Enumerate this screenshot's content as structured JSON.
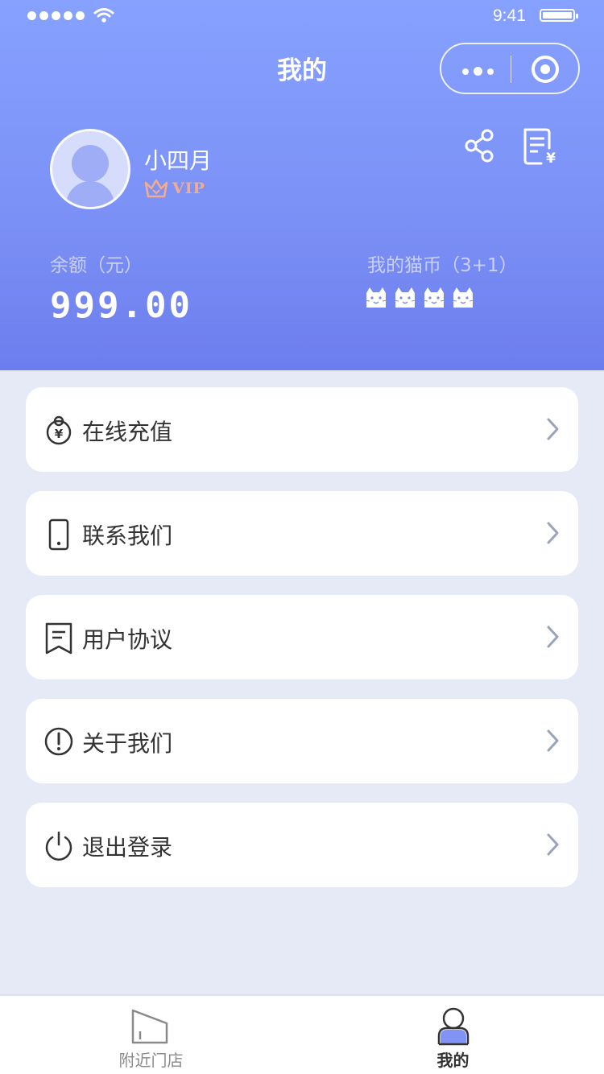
{
  "status_bar": {
    "time": "9:41"
  },
  "header": {
    "title": "我的"
  },
  "profile": {
    "name": "小四月",
    "vip_label": "VIP"
  },
  "wallet": {
    "balance_label": "余额（元）",
    "balance_value": "999.00",
    "coins_label": "我的猫币（3+1）",
    "coins_count": 4
  },
  "menu": [
    {
      "label": "在线充值",
      "icon": "recharge-icon"
    },
    {
      "label": "联系我们",
      "icon": "phone-icon"
    },
    {
      "label": "用户协议",
      "icon": "agreement-icon"
    },
    {
      "label": "关于我们",
      "icon": "info-icon"
    },
    {
      "label": "退出登录",
      "icon": "power-icon"
    }
  ],
  "tabs": [
    {
      "label": "附近门店",
      "icon": "store-icon",
      "active": false
    },
    {
      "label": "我的",
      "icon": "profile-icon",
      "active": true
    }
  ],
  "colors": {
    "header_gradient_top": "#86a1ff",
    "header_gradient_bottom": "#6c7ded",
    "page_background": "#e6eaf6",
    "accent": "#8193f5",
    "vip": "#f4ad8c"
  }
}
